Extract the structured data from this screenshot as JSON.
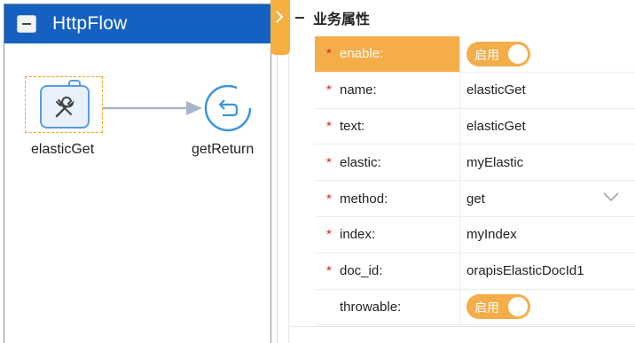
{
  "flow": {
    "title": "HttpFlow",
    "nodes": [
      {
        "label": "elasticGet",
        "icon": "tools-icon"
      },
      {
        "label": "getReturn",
        "icon": "return-icon"
      }
    ]
  },
  "properties": {
    "section_title": "业务属性",
    "rows": [
      {
        "key": "enable:",
        "required": true,
        "value": "",
        "toggle_label": "启用",
        "active": true
      },
      {
        "key": "name:",
        "required": true,
        "value": "elasticGet"
      },
      {
        "key": "text:",
        "required": true,
        "value": "elasticGet"
      },
      {
        "key": "elastic:",
        "required": true,
        "value": "myElastic"
      },
      {
        "key": "method:",
        "required": true,
        "value": "get"
      },
      {
        "key": "index:",
        "required": true,
        "value": "myIndex"
      },
      {
        "key": "doc_id:",
        "required": true,
        "value": "orapisElasticDocId1"
      },
      {
        "key": "throwable:",
        "required": false,
        "value": "",
        "toggle_label": "启用"
      }
    ],
    "required_mark": "*"
  },
  "colors": {
    "header": "#1461c2",
    "accent": "#f5ad4a",
    "node_blue": "#5a9be6",
    "required": "#e02020"
  }
}
